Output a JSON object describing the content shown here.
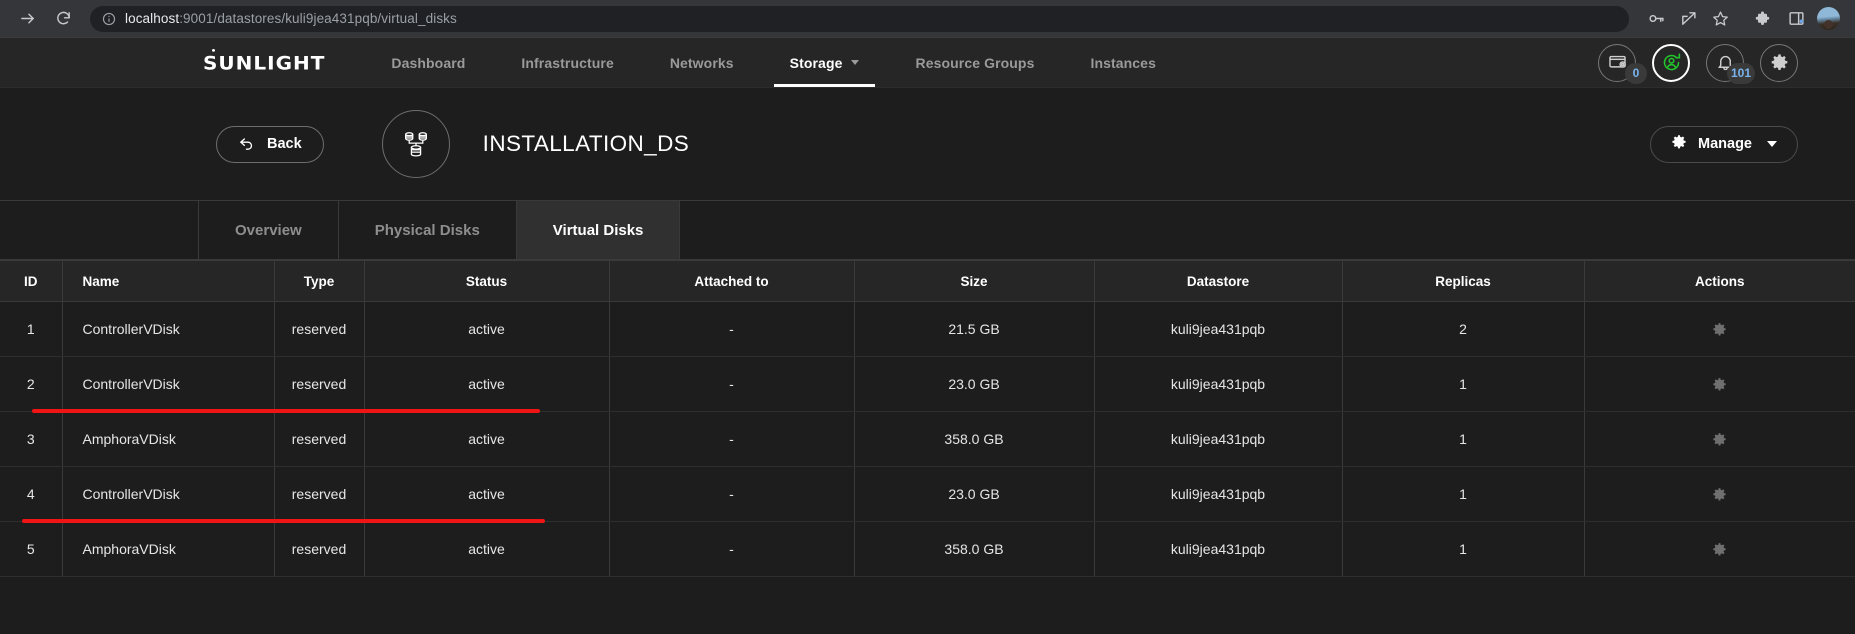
{
  "browser": {
    "url_host": "localhost",
    "url_rest": ":9001/datastores/kuli9jea431pqb/virtual_disks",
    "forward_icon": "forward-arrow-icon",
    "reload_icon": "reload-icon",
    "info_icon": "site-info-icon",
    "toolbar_icons": [
      "key-icon",
      "share-icon",
      "bookmark-star-icon",
      "extensions-puzzle-icon",
      "side-panel-icon",
      "profile-avatar"
    ]
  },
  "app_nav": {
    "logo": "SUNLIGHT",
    "items": [
      {
        "label": "Dashboard",
        "active": false,
        "caret": false
      },
      {
        "label": "Infrastructure",
        "active": false,
        "caret": false
      },
      {
        "label": "Networks",
        "active": false,
        "caret": false
      },
      {
        "label": "Storage",
        "active": true,
        "caret": true
      },
      {
        "label": "Resource Groups",
        "active": false,
        "caret": false
      },
      {
        "label": "Instances",
        "active": false,
        "caret": false
      }
    ],
    "status_icons": [
      {
        "name": "vm-console-icon",
        "badge": "0",
        "highlight": false
      },
      {
        "name": "user-sync-icon",
        "badge": "",
        "highlight": true
      },
      {
        "name": "notifications-bell-icon",
        "badge": "101",
        "highlight": false
      },
      {
        "name": "settings-gear-icon",
        "badge": "",
        "highlight": false
      }
    ]
  },
  "page_header": {
    "back_label": "Back",
    "back_icon": "back-arrow-icon",
    "datastore_icon": "datastore-cluster-icon",
    "title": "INSTALLATION_DS",
    "manage_label": "Manage",
    "manage_icon": "gear-icon"
  },
  "tabs": [
    {
      "label": "Overview",
      "active": false
    },
    {
      "label": "Physical Disks",
      "active": false
    },
    {
      "label": "Virtual Disks",
      "active": true
    }
  ],
  "table": {
    "columns": [
      "ID",
      "Name",
      "Type",
      "Status",
      "Attached to",
      "Size",
      "Datastore",
      "Replicas",
      "Actions"
    ],
    "action_icon": "gear-icon",
    "rows": [
      {
        "id": "1",
        "name": "ControllerVDisk",
        "type": "reserved",
        "status": "active",
        "attached_to": "-",
        "size": "21.5 GB",
        "datastore": "kuli9jea431pqb",
        "replicas": "2"
      },
      {
        "id": "2",
        "name": "ControllerVDisk",
        "type": "reserved",
        "status": "active",
        "attached_to": "-",
        "size": "23.0 GB",
        "datastore": "kuli9jea431pqb",
        "replicas": "1"
      },
      {
        "id": "3",
        "name": "AmphoraVDisk",
        "type": "reserved",
        "status": "active",
        "attached_to": "-",
        "size": "358.0 GB",
        "datastore": "kuli9jea431pqb",
        "replicas": "1"
      },
      {
        "id": "4",
        "name": "ControllerVDisk",
        "type": "reserved",
        "status": "active",
        "attached_to": "-",
        "size": "23.0 GB",
        "datastore": "kuli9jea431pqb",
        "replicas": "1"
      },
      {
        "id": "5",
        "name": "AmphoraVDisk",
        "type": "reserved",
        "status": "active",
        "attached_to": "-",
        "size": "358.0 GB",
        "datastore": "kuli9jea431pqb",
        "replicas": "1"
      }
    ]
  },
  "annotations": {
    "color": "#f01414",
    "marks": [
      {
        "name": "highlight-underline-row-3"
      },
      {
        "name": "highlight-underline-row-5"
      }
    ]
  }
}
